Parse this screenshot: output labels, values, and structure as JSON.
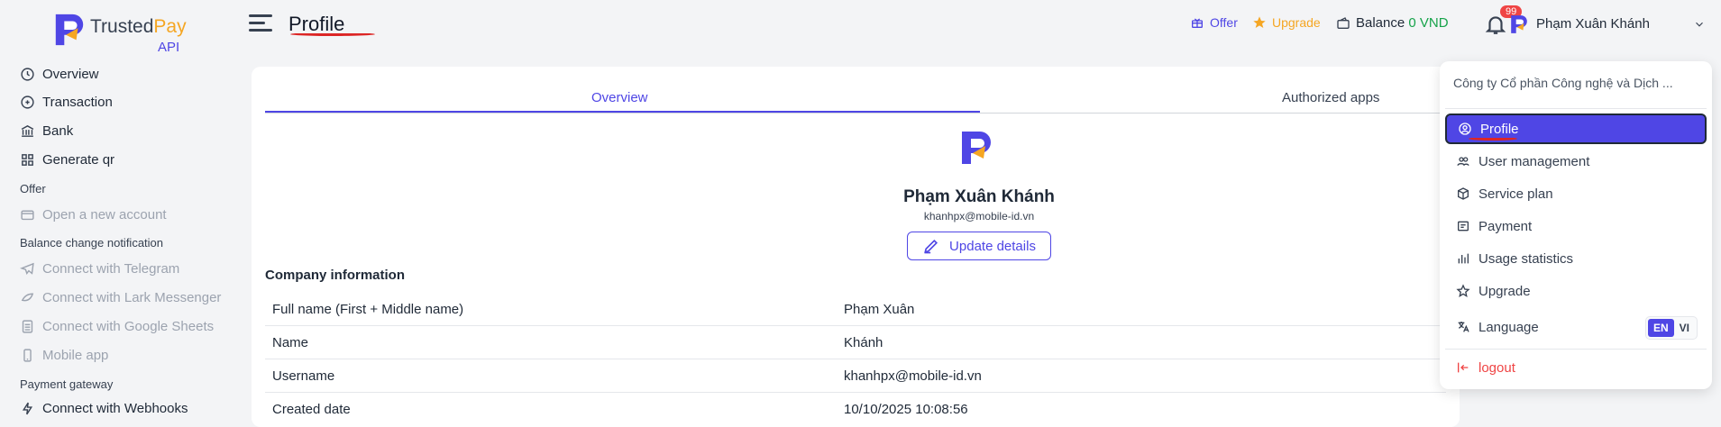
{
  "brand": {
    "name_main": "Trusted",
    "name_accent": "Pay",
    "sub": "API"
  },
  "sidebar": {
    "items": [
      {
        "label": "Overview",
        "icon": "clock-icon"
      },
      {
        "label": "Transaction",
        "icon": "transaction-icon"
      },
      {
        "label": "Bank",
        "icon": "bank-icon"
      },
      {
        "label": "Generate qr",
        "icon": "qr-icon"
      }
    ],
    "section_offer": "Offer",
    "offer_items": [
      {
        "label": "Open a new account",
        "icon": "card-plus-icon"
      }
    ],
    "section_balance": "Balance change notification",
    "balance_items": [
      {
        "label": "Connect with Telegram",
        "icon": "telegram-icon"
      },
      {
        "label": "Connect with Lark Messenger",
        "icon": "lark-icon"
      },
      {
        "label": "Connect with Google Sheets",
        "icon": "sheets-icon"
      },
      {
        "label": "Mobile app",
        "icon": "mobile-icon"
      }
    ],
    "section_gateway": "Payment gateway",
    "gateway_items": [
      {
        "label": "Connect with Webhooks",
        "icon": "webhook-icon"
      }
    ]
  },
  "header": {
    "title": "Profile",
    "offer": "Offer",
    "upgrade": "Upgrade",
    "balance_label": "Balance",
    "balance_value": "0 VND",
    "notifications": "99",
    "user_name": "Phạm Xuân Khánh"
  },
  "tabs": [
    "Overview",
    "Authorized apps"
  ],
  "profile": {
    "name": "Phạm Xuân Khánh",
    "email": "khanhpx@mobile-id.vn",
    "update_button": "Update details"
  },
  "company": {
    "title": "Company information",
    "rows": [
      {
        "key": "Full name (First + Middle name)",
        "value": "Phạm Xuân"
      },
      {
        "key": "Name",
        "value": "Khánh"
      },
      {
        "key": "Username",
        "value": "khanhpx@mobile-id.vn"
      },
      {
        "key": "Created date",
        "value": "10/10/2025 10:08:56"
      }
    ]
  },
  "dropdown": {
    "company": "Công ty Cổ phần Công nghệ và Dịch ...",
    "items": [
      {
        "label": "Profile",
        "icon": "user-circle-icon"
      },
      {
        "label": "User management",
        "icon": "users-icon"
      },
      {
        "label": "Service plan",
        "icon": "box-icon"
      },
      {
        "label": "Payment",
        "icon": "receipt-icon"
      },
      {
        "label": "Usage statistics",
        "icon": "bar-chart-icon"
      },
      {
        "label": "Upgrade",
        "icon": "star-icon"
      }
    ],
    "language_label": "Language",
    "lang_en": "EN",
    "lang_vi": "VI",
    "logout": "logout"
  },
  "colors": {
    "accent": "#4f46e5",
    "brand_orange": "#f5a623",
    "balance_green": "#16a34a",
    "danger": "#ef4444"
  }
}
